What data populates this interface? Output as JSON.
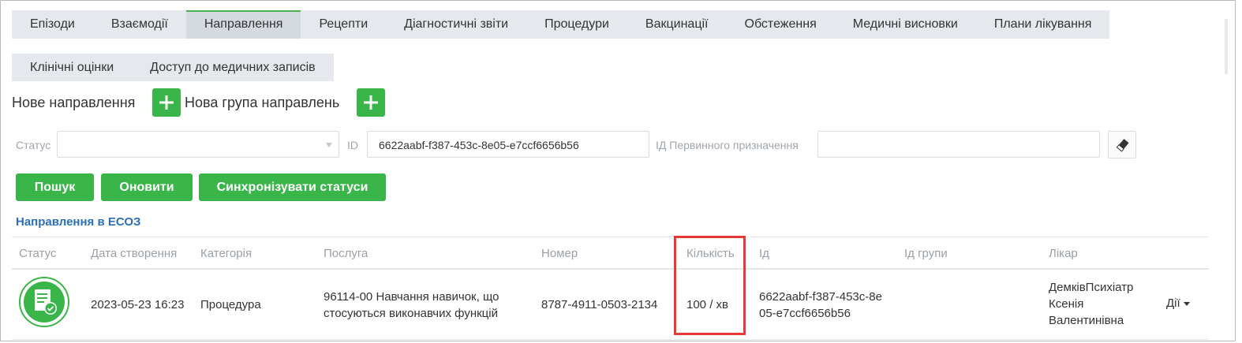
{
  "tabs_row1": [
    "Епізоди",
    "Взаємодії",
    "Направлення",
    "Рецепти",
    "Діагностичні звіти",
    "Процедури",
    "Вакцинації",
    "Обстеження",
    "Медичні висновки",
    "Плани лікування"
  ],
  "tabs_row2": [
    "Клінічні оцінки",
    "Доступ до медичних записів"
  ],
  "active_tab": "Направлення",
  "new_referral_label": "Нове направлення",
  "new_group_label": "Нова група направлень",
  "filters": {
    "status_label": "Статус",
    "status_value": "",
    "id_label": "ID",
    "id_value": "6622aabf-f387-453c-8e05-e7ccf6656b56",
    "primary_id_label": "ІД Первинного призначення",
    "primary_id_value": ""
  },
  "buttons": {
    "search": "Пошук",
    "refresh": "Оновити",
    "sync": "Синхронізувати статуси"
  },
  "section_title": "Направлення в ЕСОЗ",
  "columns": {
    "status": "Статус",
    "created": "Дата створення",
    "category": "Категорія",
    "service": "Послуга",
    "number": "Номер",
    "quantity": "Кількість",
    "id": "Ід",
    "group_id": "Ід групи",
    "doctor": "Лікар"
  },
  "rows": [
    {
      "status_icon": "document-check-icon",
      "created": "2023-05-23 16:23",
      "category": "Процедура",
      "service": "96114-00 Навчання навичок, що стосуються виконавчих функцій",
      "number": "8787-4911-0503-2134",
      "quantity": "100 / хв",
      "id": "6622aabf-f387-453c-8e05-e7ccf6656b56",
      "group_id": "",
      "doctor": "ДемківПсихіатр Ксенія Валентинівна",
      "actions_label": "Дії"
    }
  ],
  "colors": {
    "accent_green": "#3ab54a",
    "link_blue": "#2a6fb8",
    "highlight_red": "#e53935"
  }
}
